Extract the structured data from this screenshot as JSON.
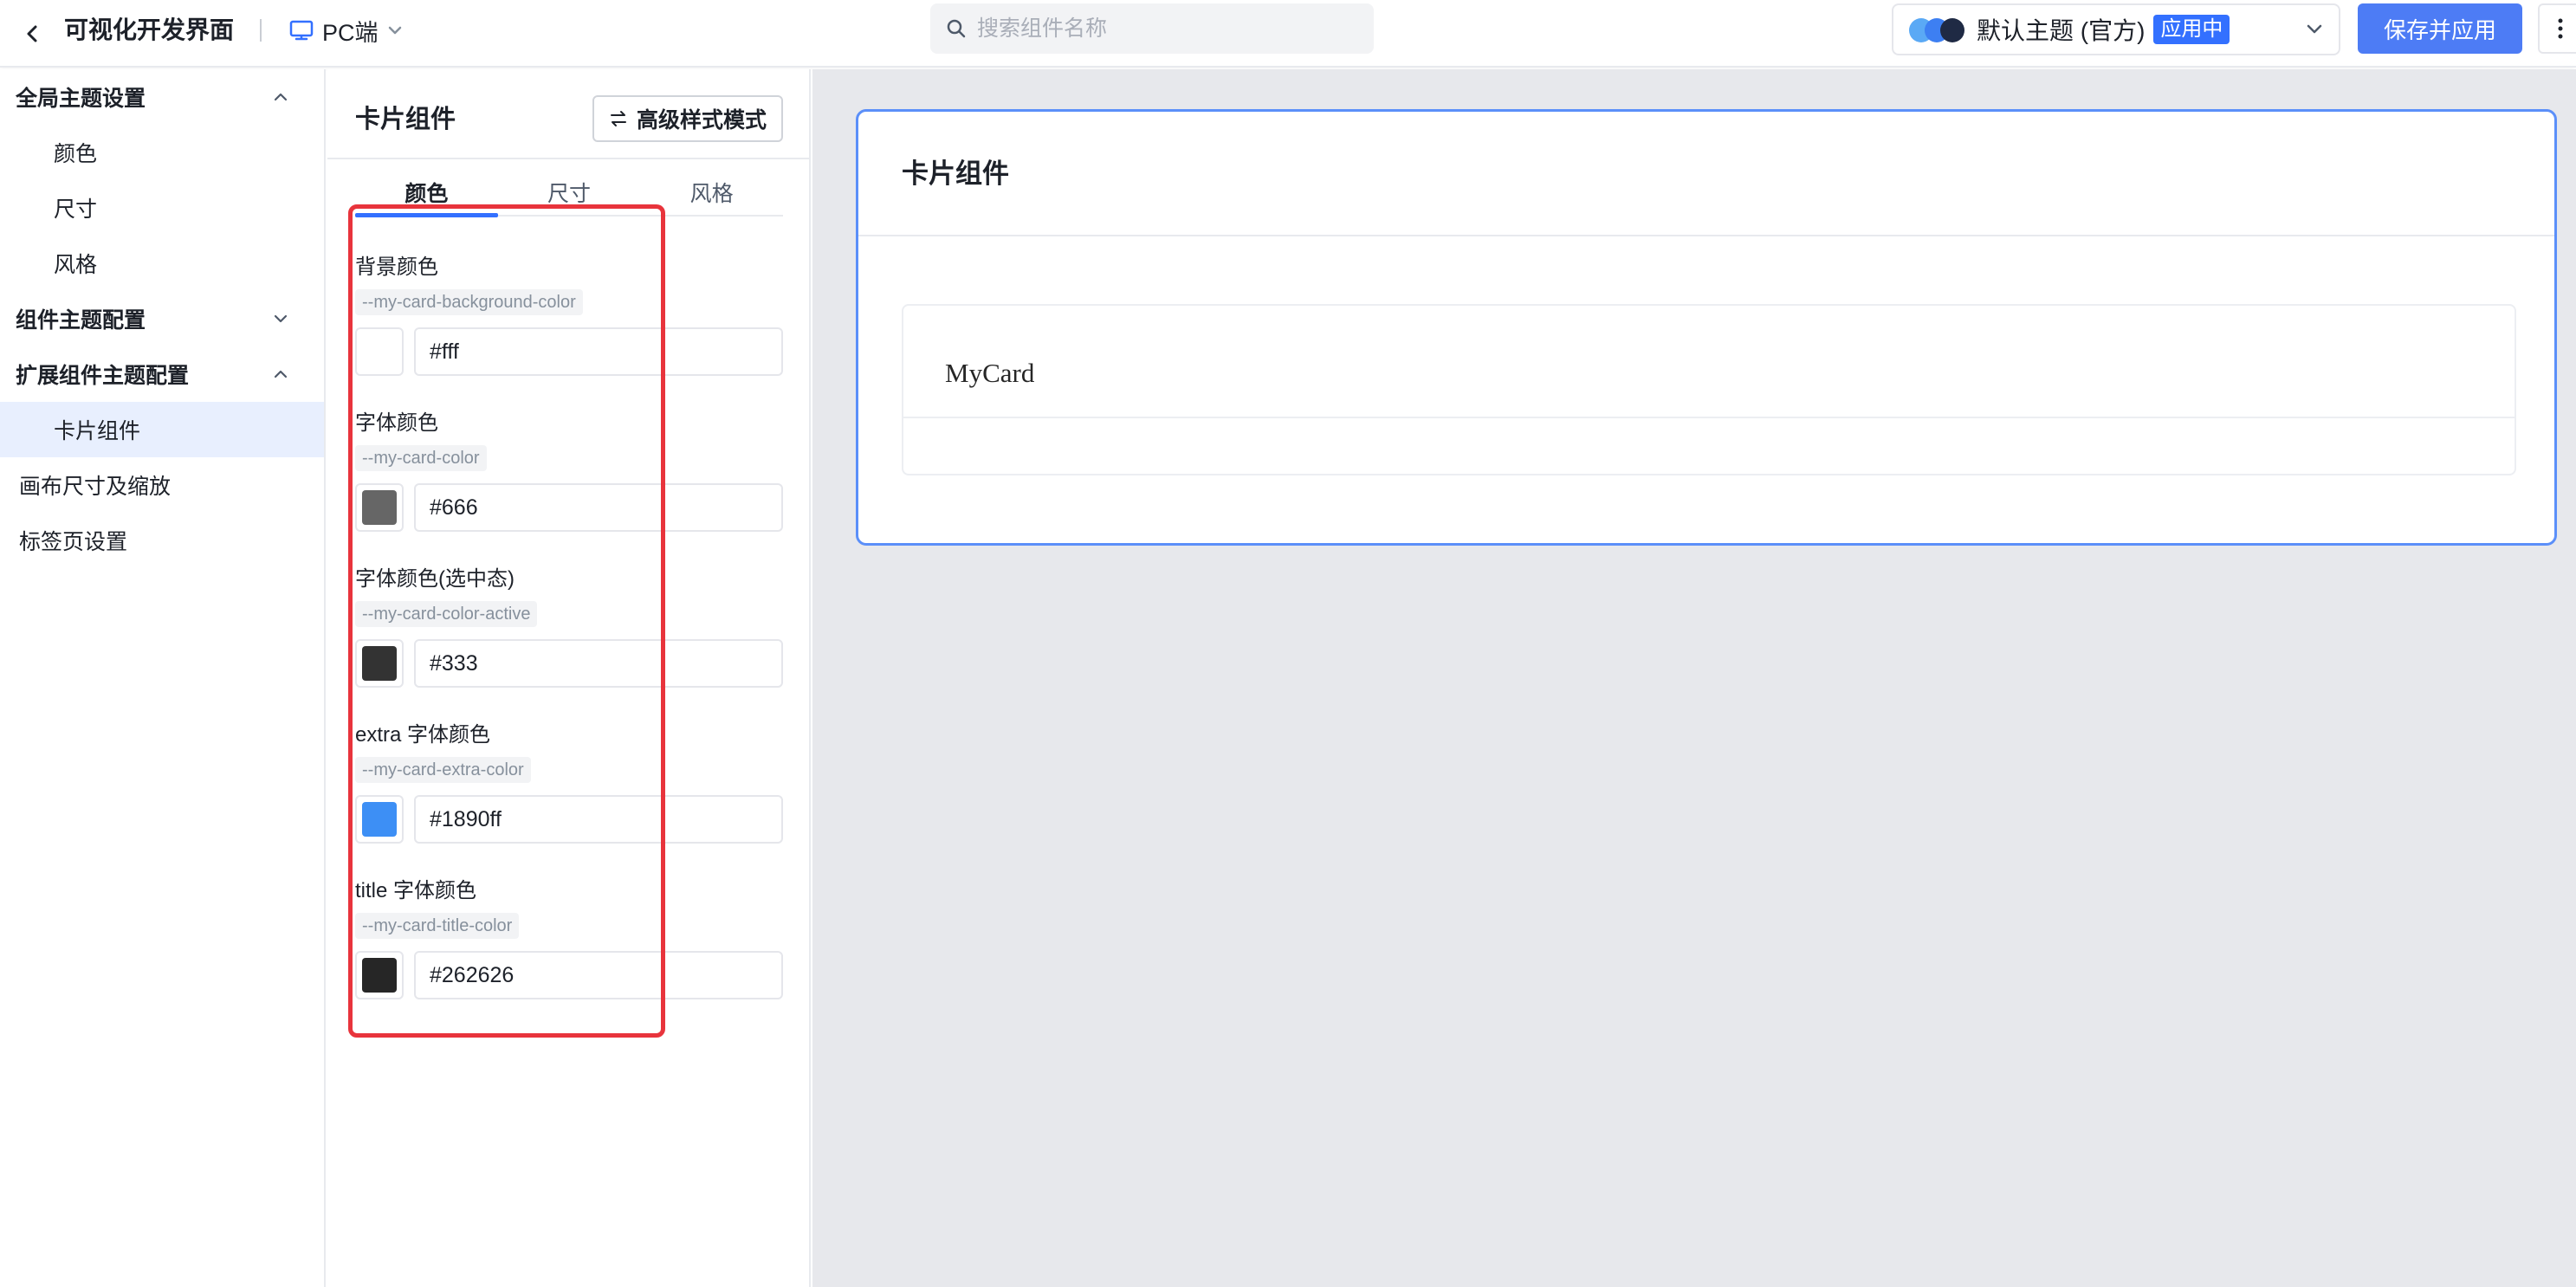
{
  "header": {
    "back_icon": "chevron-left-icon",
    "title": "可视化开发界面",
    "platform_label": "PC端",
    "platform_icon": "monitor-icon",
    "search_placeholder": "搜索组件名称",
    "theme": {
      "name": "默认主题 (官方)",
      "badge": "应用中",
      "dot_colors": [
        "#5aa9f5",
        "#3d7ff2",
        "#1f2a44"
      ]
    },
    "save_label": "保存并应用",
    "more_icon": "more-vertical-icon"
  },
  "sidebar": {
    "groups": [
      {
        "label": "全局主题设置",
        "expanded": true,
        "items": [
          "颜色",
          "尺寸",
          "风格"
        ]
      },
      {
        "label": "组件主题配置",
        "expanded": false,
        "items": []
      },
      {
        "label": "扩展组件主题配置",
        "expanded": true,
        "items": [
          "卡片组件"
        ]
      }
    ],
    "active_item": "卡片组件",
    "plain_items": [
      "画布尺寸及缩放",
      "标签页设置"
    ]
  },
  "panel": {
    "title": "卡片组件",
    "advanced_button": "高级样式模式",
    "tabs": [
      "颜色",
      "尺寸",
      "风格"
    ],
    "active_tab": "颜色",
    "fields": [
      {
        "label": "背景颜色",
        "var": "--my-card-background-color",
        "value": "#fff",
        "swatch": "#ffffff"
      },
      {
        "label": "字体颜色",
        "var": "--my-card-color",
        "value": "#666",
        "swatch": "#666666"
      },
      {
        "label": "字体颜色(选中态)",
        "var": "--my-card-color-active",
        "value": "#333",
        "swatch": "#333333"
      },
      {
        "label": "extra 字体颜色",
        "var": "--my-card-extra-color",
        "value": "#1890ff",
        "swatch": "#3d8ff5"
      },
      {
        "label": "title 字体颜色",
        "var": "--my-card-title-color",
        "value": "#262626",
        "swatch": "#262626"
      }
    ]
  },
  "preview": {
    "card_title": "卡片组件",
    "mycard_title": "MyCard"
  },
  "colors": {
    "accent": "#3370ff",
    "save_button": "#4d7cf5",
    "highlight_box": "#e8343c",
    "canvas_bg": "#e7e8ec"
  }
}
